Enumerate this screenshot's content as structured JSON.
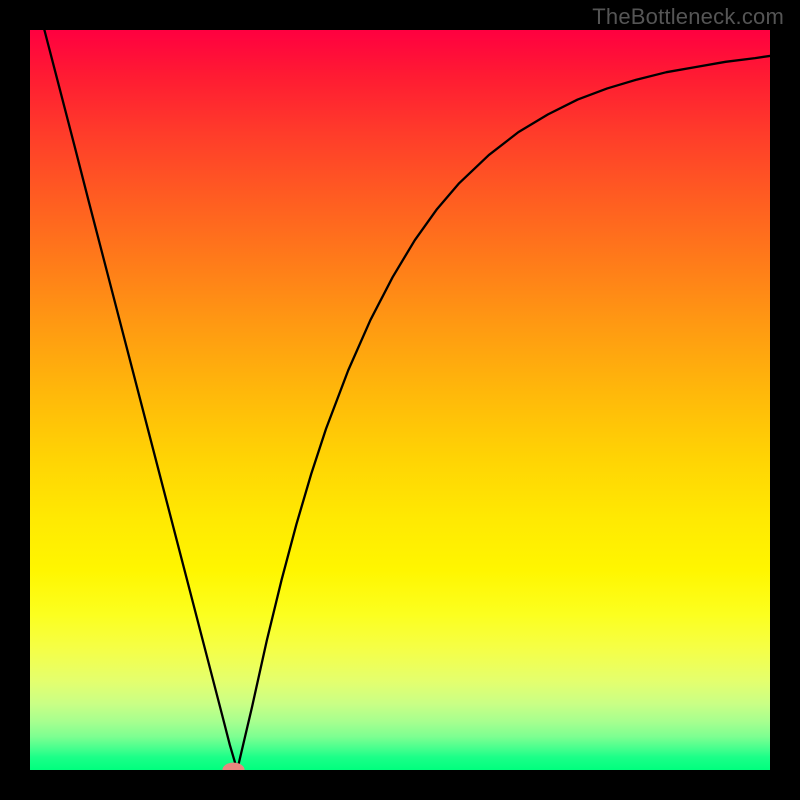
{
  "watermark": "TheBottleneck.com",
  "chart_data": {
    "type": "line",
    "title": "",
    "xlabel": "",
    "ylabel": "",
    "xlim": [
      0,
      1
    ],
    "ylim": [
      0,
      1
    ],
    "grid": false,
    "legend": false,
    "background_gradient": {
      "top": "#ff0040",
      "bottom": "#00ff7e",
      "direction": "vertical"
    },
    "series": [
      {
        "name": "curve",
        "x": [
          0.0,
          0.02,
          0.04,
          0.06,
          0.08,
          0.1,
          0.12,
          0.14,
          0.16,
          0.18,
          0.2,
          0.22,
          0.24,
          0.26,
          0.27,
          0.28,
          0.3,
          0.32,
          0.34,
          0.36,
          0.38,
          0.4,
          0.43,
          0.46,
          0.49,
          0.52,
          0.55,
          0.58,
          0.62,
          0.66,
          0.7,
          0.74,
          0.78,
          0.82,
          0.86,
          0.9,
          0.94,
          0.98,
          1.0
        ],
        "y": [
          1.075,
          0.998,
          0.921,
          0.844,
          0.766,
          0.689,
          0.612,
          0.535,
          0.458,
          0.381,
          0.304,
          0.227,
          0.15,
          0.073,
          0.034,
          0.0,
          0.085,
          0.175,
          0.257,
          0.332,
          0.4,
          0.461,
          0.54,
          0.608,
          0.666,
          0.716,
          0.758,
          0.793,
          0.831,
          0.862,
          0.886,
          0.906,
          0.921,
          0.933,
          0.943,
          0.95,
          0.957,
          0.962,
          0.965
        ]
      }
    ],
    "markers": [
      {
        "name": "min-point",
        "x": 0.275,
        "y": 0.0,
        "rx": 0.015,
        "ry": 0.01,
        "color": "#e8877f"
      }
    ]
  }
}
